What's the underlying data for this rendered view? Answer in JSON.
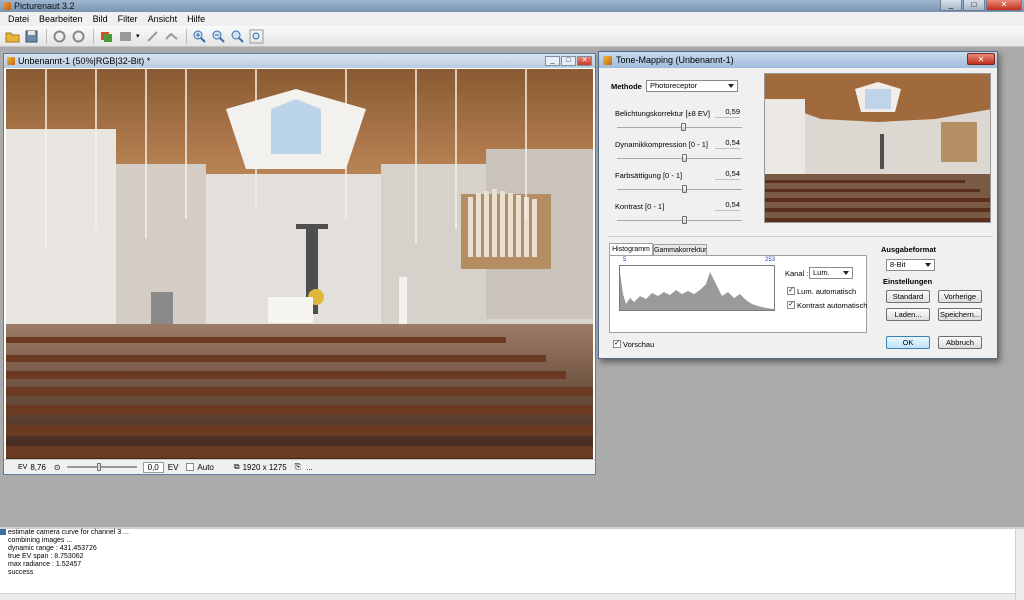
{
  "app": {
    "title": "Picturenaut 3.2"
  },
  "menu": [
    "Datei",
    "Bearbeiten",
    "Bild",
    "Filter",
    "Ansicht",
    "Hilfe"
  ],
  "toolbar": {
    "icons": [
      "open-folder-icon",
      "save-icon",
      "undo-icon",
      "redo-icon",
      "hdr-generate-icon",
      "layers-icon",
      "crop-icon",
      "transform-icon",
      "zoom-in-icon",
      "zoom-out-icon",
      "zoom-fit-icon",
      "zoom-100-icon"
    ]
  },
  "document": {
    "title": "Unbenannt-1 (50%|RGB|32-Bit) *",
    "ev_label": "EV",
    "ev_value": "8,76",
    "exposure_value": "0,0",
    "exposure_unit": "EV",
    "auto_label": "Auto",
    "dimensions": "1920 x 1275",
    "ellipsis": "..."
  },
  "dialog": {
    "title": "Tone-Mapping (Unbenannt-1)",
    "method_label": "Methode",
    "method_value": "Photoreceptor",
    "params": [
      {
        "label": "Belichtungskorrektur [±8 EV]",
        "value": "0,59",
        "level": 0.537
      },
      {
        "label": "Dynamikkompression [0 - 1]",
        "value": "0,54",
        "level": 0.54
      },
      {
        "label": "Farbsättigung [0 - 1]",
        "value": "0,54",
        "level": 0.54
      },
      {
        "label": "Kontrast [0 - 1]",
        "value": "0,54",
        "level": 0.54
      }
    ],
    "tabs": [
      "Histogramm",
      "Gammakorrektur"
    ],
    "hist_min": "5",
    "hist_max": "253",
    "channel_label": "Kanal :",
    "channel_value": "Lum.",
    "lum_auto": "Lum. automatisch",
    "contrast_auto": "Kontrast automatisch",
    "output_label": "Ausgabeformat",
    "output_value": "8-Bit",
    "settings_label": "Einstellungen",
    "btn_standard": "Standard",
    "btn_previous": "Vorherige",
    "btn_load": "Laden...",
    "btn_save": "Speichern...",
    "preview_label": "Vorschau",
    "btn_ok": "OK",
    "btn_cancel": "Abbruch"
  },
  "log": [
    "estimate camera curve for channel 3 ...",
    "combining images ...",
    "dynamic range : 431.453726",
    "true EV span  : 8.753062",
    "max radiance  : 1.52457",
    "success"
  ],
  "colors": {
    "titlebar": "#8aa3c1",
    "dialog_border": "#4e6b8f",
    "histogram": "#9a9a9a"
  }
}
